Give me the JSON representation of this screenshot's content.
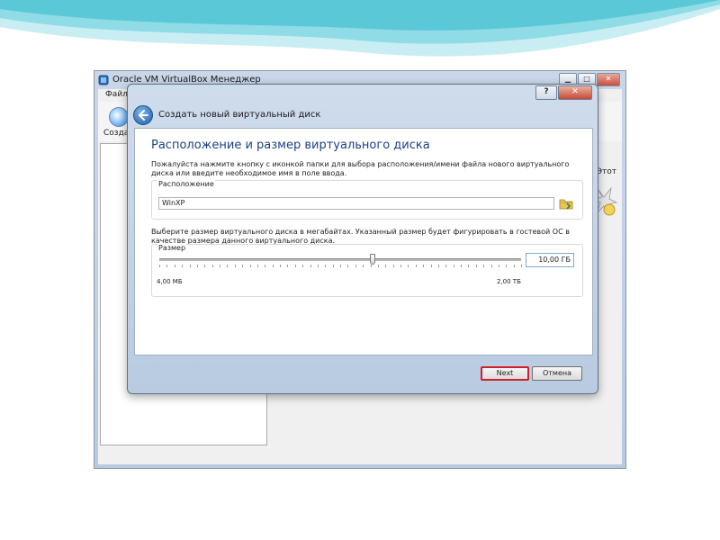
{
  "background_window": {
    "title": "Oracle VM VirtualBox Менеджер",
    "menu_file": "Файл",
    "toolbar_create": "Создат",
    "right_partial_label": "Этот"
  },
  "dialog": {
    "title": "Создать новый виртуальный диск",
    "help_button": "?",
    "heading": "Расположение и размер виртуального диска",
    "location_description": "Пожалуйста нажмите кнопку с иконкой папки для выбора расположения/имени файла нового виртуального диска или введите необходимое имя в поле ввода.",
    "location_group_label": "Расположение",
    "location_value": "WinXP",
    "size_description": "Выберите размер виртуального диска в мегабайтах. Указанный размер будет фигурировать в гостевой ОС в качестве размера данного виртуального диска.",
    "size_group_label": "Размер",
    "size_value": "10,00 ГБ",
    "slider_min_label": "4,00 МБ",
    "slider_max_label": "2,00 ТБ",
    "slider_position_fraction": 0.59,
    "next_button": "Next",
    "cancel_button": "Отмена"
  },
  "colors": {
    "heading": "#1c3f88",
    "next_highlight": "#d0202a",
    "slide_wave": "#5bc8d8"
  }
}
